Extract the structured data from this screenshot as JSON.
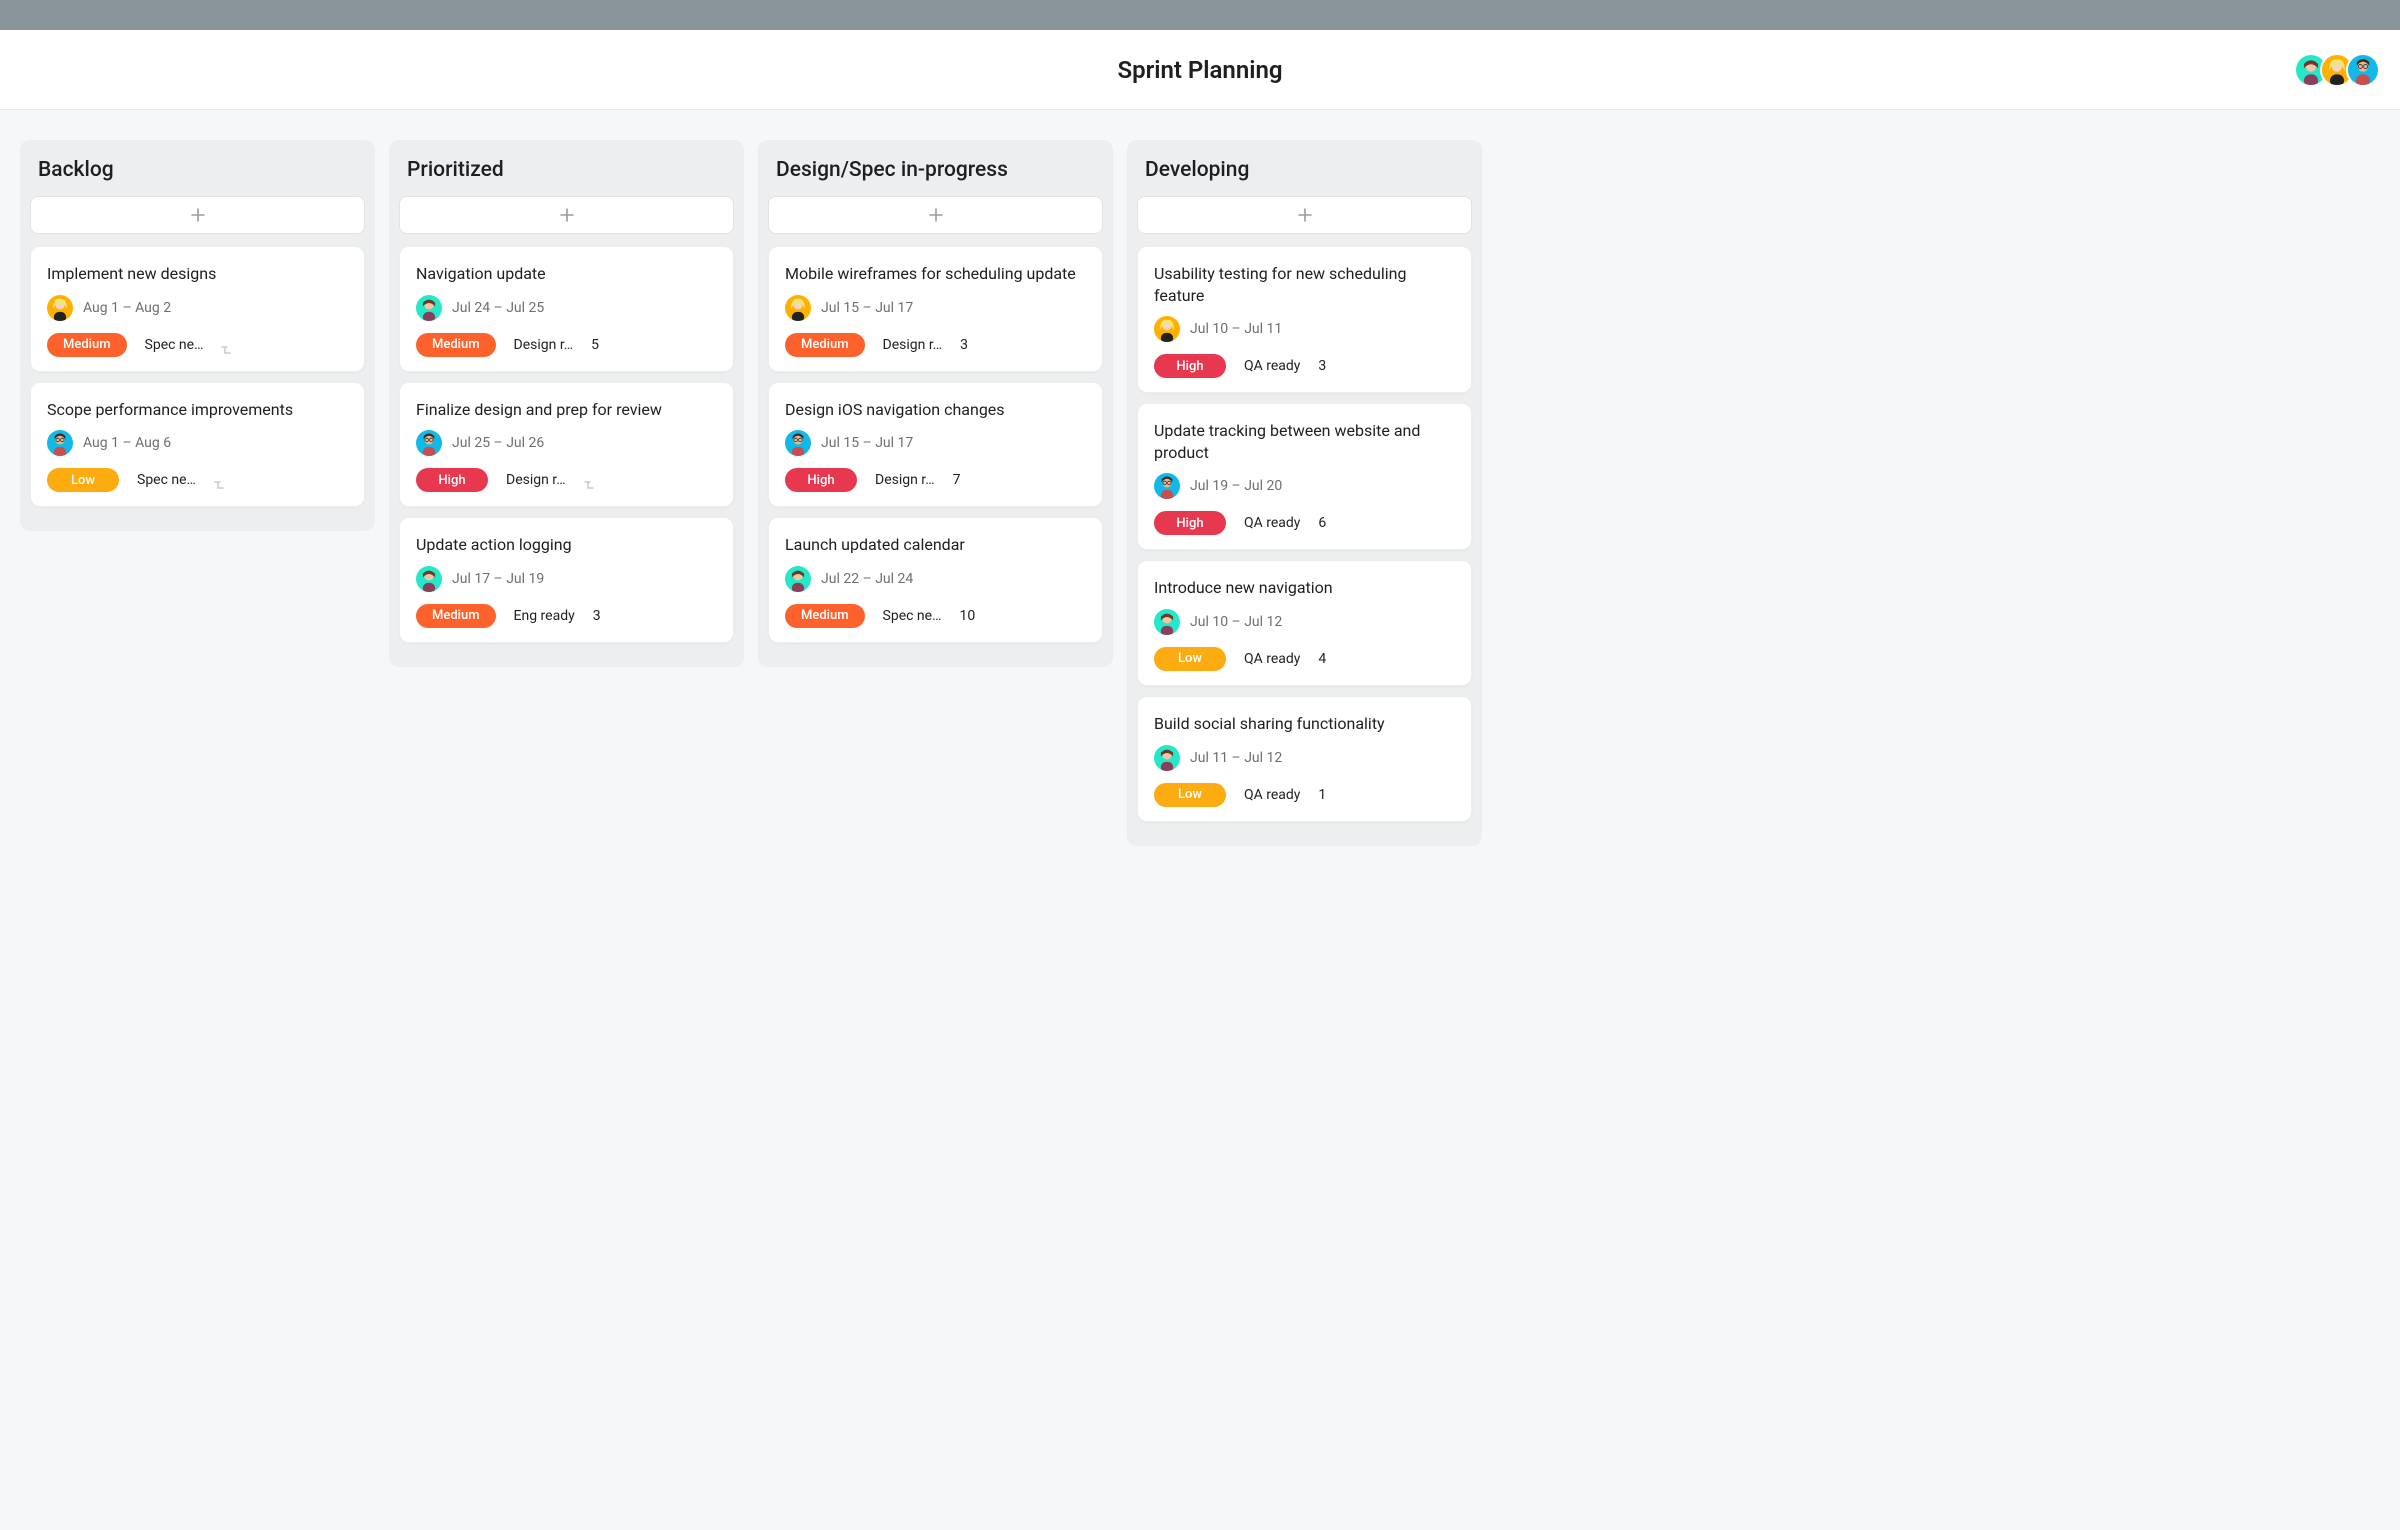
{
  "header": {
    "title": "Sprint Planning",
    "avatars": [
      "green",
      "orange",
      "cyan"
    ]
  },
  "priority_labels": {
    "medium": "Medium",
    "high": "High",
    "low": "Low"
  },
  "columns": [
    {
      "title": "Backlog",
      "cards": [
        {
          "title": "Implement new designs",
          "avatar": "orange",
          "date": "Aug 1 – Aug 2",
          "priority": "medium",
          "status": "Spec ne…",
          "count": null,
          "subtask_icon": true
        },
        {
          "title": "Scope performance improvements",
          "avatar": "cyan",
          "date": "Aug 1 – Aug 6",
          "priority": "low",
          "status": "Spec ne…",
          "count": null,
          "subtask_icon": true
        }
      ]
    },
    {
      "title": "Prioritized",
      "cards": [
        {
          "title": "Navigation update",
          "avatar": "green",
          "date": "Jul 24 – Jul 25",
          "priority": "medium",
          "status": "Design r…",
          "count": 5,
          "subtask_icon": false
        },
        {
          "title": "Finalize design and prep for review",
          "avatar": "cyan",
          "date": "Jul 25 – Jul 26",
          "priority": "high",
          "status": "Design r…",
          "count": null,
          "subtask_icon": true
        },
        {
          "title": "Update action logging",
          "avatar": "green",
          "date": "Jul 17 – Jul 19",
          "priority": "medium",
          "status": "Eng ready",
          "count": 3,
          "subtask_icon": false
        }
      ]
    },
    {
      "title": "Design/Spec in-progress",
      "cards": [
        {
          "title": "Mobile wireframes for scheduling update",
          "avatar": "orange",
          "date": "Jul 15 – Jul 17",
          "priority": "medium",
          "status": "Design r…",
          "count": 3,
          "subtask_icon": false
        },
        {
          "title": "Design iOS navigation changes",
          "avatar": "cyan",
          "date": "Jul 15 – Jul 17",
          "priority": "high",
          "status": "Design r…",
          "count": 7,
          "subtask_icon": false
        },
        {
          "title": "Launch updated calendar",
          "avatar": "green",
          "date": "Jul 22 – Jul 24",
          "priority": "medium",
          "status": "Spec ne…",
          "count": 10,
          "subtask_icon": false
        }
      ]
    },
    {
      "title": "Developing",
      "cards": [
        {
          "title": "Usability testing for new scheduling feature",
          "avatar": "orange",
          "date": "Jul 10 – Jul 11",
          "priority": "high",
          "status": "QA ready",
          "count": 3,
          "subtask_icon": false
        },
        {
          "title": "Update tracking between website and product",
          "avatar": "cyan",
          "date": "Jul 19 – Jul 20",
          "priority": "high",
          "status": "QA ready",
          "count": 6,
          "subtask_icon": false
        },
        {
          "title": "Introduce new navigation",
          "avatar": "green",
          "date": "Jul 10 – Jul 12",
          "priority": "low",
          "status": "QA ready",
          "count": 4,
          "subtask_icon": false
        },
        {
          "title": "Build social sharing functionality",
          "avatar": "green",
          "date": "Jul 11 – Jul 12",
          "priority": "low",
          "status": "QA ready",
          "count": 1,
          "subtask_icon": false
        }
      ]
    }
  ]
}
